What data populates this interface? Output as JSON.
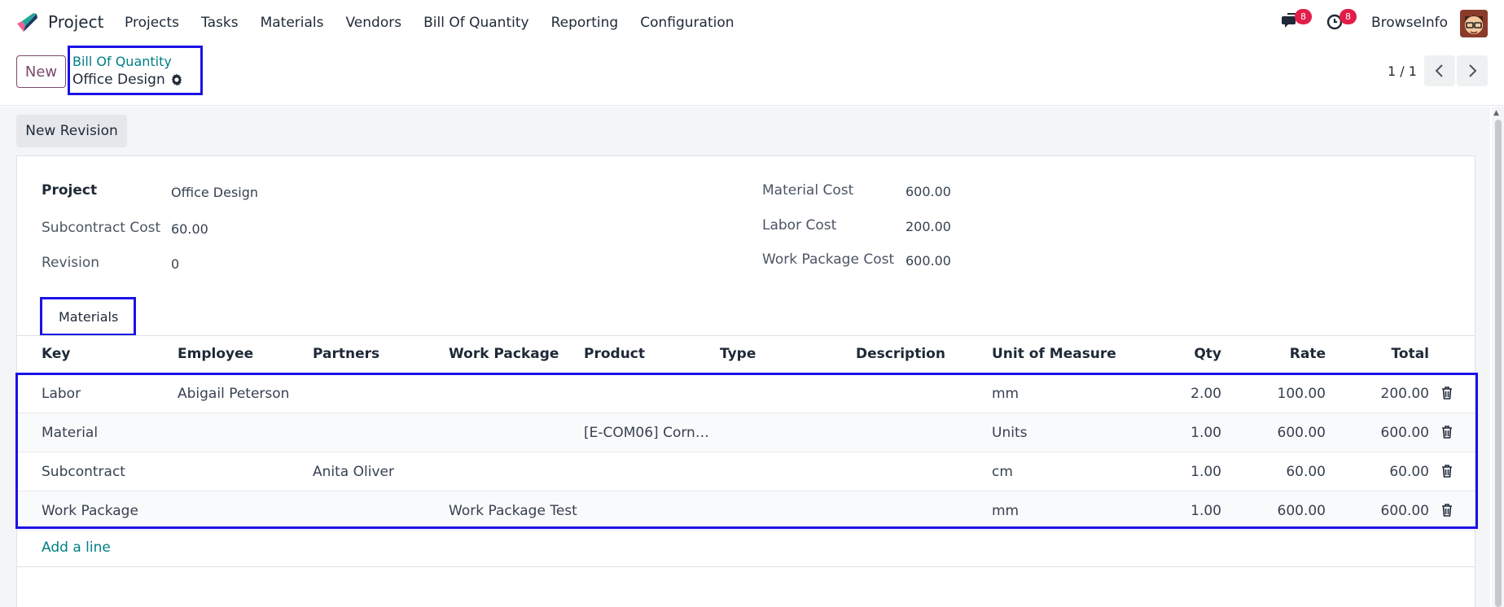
{
  "app": {
    "title": "Project"
  },
  "menu": [
    "Projects",
    "Tasks",
    "Materials",
    "Vendors",
    "Bill Of Quantity",
    "Reporting",
    "Configuration"
  ],
  "systray": {
    "messages_count": "8",
    "activities_count": "8",
    "user_name": "BrowseInfo"
  },
  "control_panel": {
    "new_label": "New",
    "breadcrumb_parent": "Bill Of Quantity",
    "breadcrumb_current": "Office Design",
    "pager_value": "1 / 1"
  },
  "actions": {
    "new_revision_label": "New Revision"
  },
  "form": {
    "project_label": "Project",
    "project_value": "Office Design",
    "subcontract_label": "Subcontract Cost",
    "subcontract_value": "60.00",
    "revision_label": "Revision",
    "revision_value": "0",
    "material_cost_label": "Material Cost",
    "material_cost_value": "600.00",
    "labor_cost_label": "Labor Cost",
    "labor_cost_value": "200.00",
    "work_package_cost_label": "Work Package Cost",
    "work_package_cost_value": "600.00"
  },
  "tabs": [
    {
      "label": "Materials"
    }
  ],
  "table": {
    "columns": [
      "Key",
      "Employee",
      "Partners",
      "Work Package",
      "Product",
      "Type",
      "Description",
      "Unit of Measure",
      "Qty",
      "Rate",
      "Total"
    ],
    "rows": [
      {
        "key": "Labor",
        "employee": "Abigail Peterson",
        "partners": "",
        "work_package": "",
        "product": "",
        "type": "",
        "description": "",
        "uom": "mm",
        "qty": "2.00",
        "rate": "100.00",
        "total": "200.00"
      },
      {
        "key": "Material",
        "employee": "",
        "partners": "",
        "work_package": "",
        "product": "[E-COM06] Corn…",
        "type": "",
        "description": "",
        "uom": "Units",
        "qty": "1.00",
        "rate": "600.00",
        "total": "600.00"
      },
      {
        "key": "Subcontract",
        "employee": "",
        "partners": "Anita Oliver",
        "work_package": "",
        "product": "",
        "type": "",
        "description": "",
        "uom": "cm",
        "qty": "1.00",
        "rate": "60.00",
        "total": "60.00"
      },
      {
        "key": "Work Package",
        "employee": "",
        "partners": "",
        "work_package": "Work Package Test",
        "product": "",
        "type": "",
        "description": "",
        "uom": "mm",
        "qty": "1.00",
        "rate": "600.00",
        "total": "600.00"
      }
    ],
    "add_line_label": "Add a line"
  },
  "colors": {
    "brand": "#7c4a6b",
    "link": "#017e84",
    "highlight": "#1a12e6",
    "badge": "#e11d48"
  },
  "icons": [
    "app-logo-icon",
    "chat-icon",
    "clock-icon",
    "gear-icon",
    "chevron-left-icon",
    "chevron-right-icon",
    "trash-icon"
  ]
}
